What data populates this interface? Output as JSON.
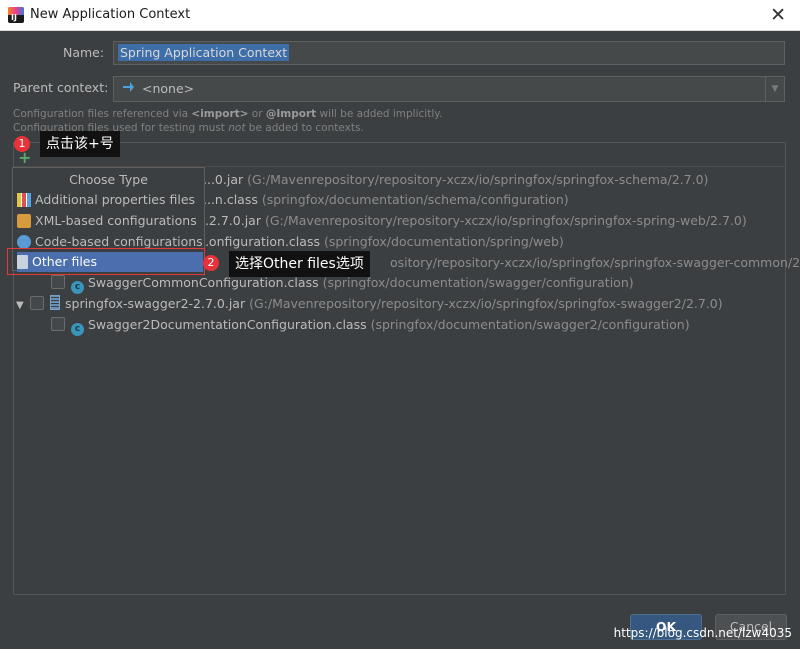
{
  "window": {
    "title": "New Application Context",
    "close_icon": "close-icon"
  },
  "form": {
    "name_label": "Name:",
    "name_value": "Spring Application Context",
    "parent_label": "Parent context:",
    "parent_value": "<none>"
  },
  "hints": {
    "line1_pre": "Configuration files referenced via ",
    "line1_import": "<import>",
    "line1_mid": " or ",
    "line1_at": "@Import",
    "line1_post": " will be added implicitly.",
    "line2_pre": "Configuration files used for testing must ",
    "line2_not": "not",
    "line2_post": " be added to contexts."
  },
  "tree": [
    {
      "main": "...0.jar",
      "path": "(G:/Mavenrepository/repository-xczx/io/springfox/springfox-schema/2.7.0)"
    },
    {
      "main": "...n.class",
      "path": "(springfox/documentation/schema/configuration)"
    },
    {
      "main": "...2.7.0.jar",
      "path": "(G:/Mavenrepository/repository-xczx/io/springfox/springfox-spring-web/2.7.0)"
    },
    {
      "main": "...onfiguration.class",
      "path": "(springfox/documentation/spring/web)"
    },
    {
      "main": "...",
      "path": "ository/repository-xczx/io/springfox/springfox-swagger-common/2.7.0)"
    },
    {
      "main": "SwaggerCommonConfiguration.class",
      "path": "(springfox/documentation/swagger/configuration)"
    },
    {
      "main": "springfox-swagger2-2.7.0.jar",
      "path": "(G:/Mavenrepository/repository-xczx/io/springfox/springfox-swagger2/2.7.0)"
    },
    {
      "main": "Swagger2DocumentationConfiguration.class",
      "path": "(springfox/documentation/swagger2/configuration)"
    }
  ],
  "popup": {
    "title": "Choose Type",
    "items": [
      {
        "label": "Additional properties files",
        "icon": "properties-file-icon"
      },
      {
        "label": "XML-based configurations",
        "icon": "xml-config-icon"
      },
      {
        "label": "Code-based configurations",
        "icon": "code-config-icon"
      },
      {
        "label": "Other files",
        "icon": "file-icon",
        "selected": true
      }
    ]
  },
  "annotations": {
    "step1_number": "1",
    "step1_text": "点击该+号",
    "step2_number": "2",
    "step2_text": "选择Other files选项"
  },
  "buttons": {
    "ok": "OK",
    "cancel": "Cancel"
  },
  "watermark": "https://blog.csdn.net/lzw4035",
  "colors": {
    "background": "#3c3f41",
    "selection": "#4b6eaf",
    "ok_button": "#365880",
    "annotation_red": "#e8323a"
  }
}
